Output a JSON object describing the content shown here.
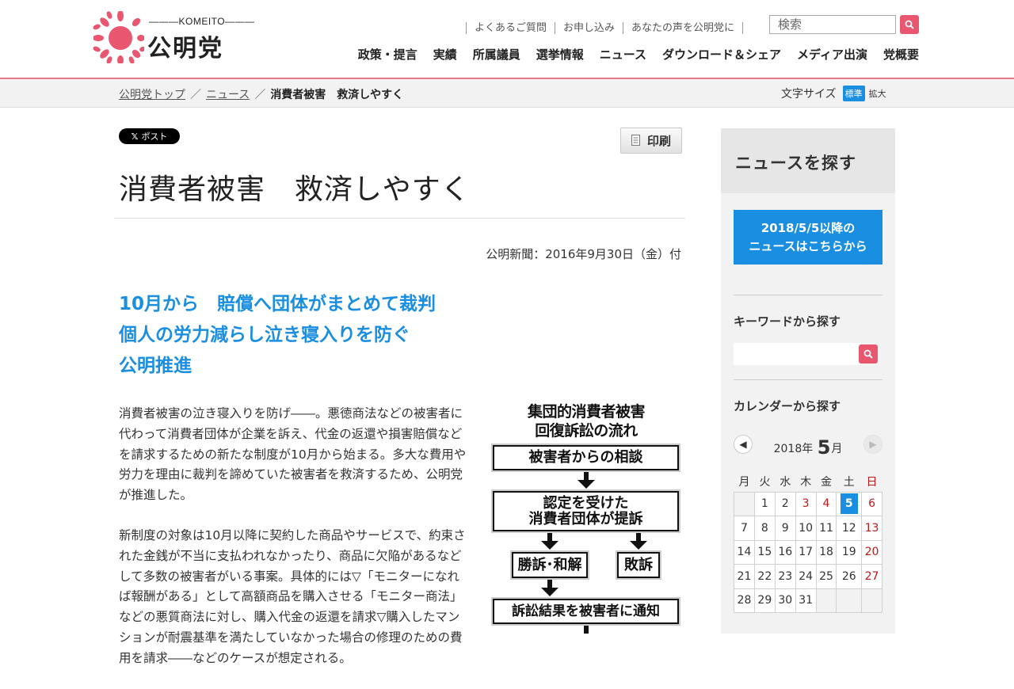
{
  "header": {
    "logo_en": "KOMEITO",
    "logo_ja": "公明党",
    "util_links": [
      "よくあるご質問",
      "お申し込み",
      "あなたの声を公明党に"
    ],
    "search_placeholder": "検索",
    "nav": [
      "政策・提言",
      "実績",
      "所属議員",
      "選挙情報",
      "ニュース",
      "ダウンロード＆シェア",
      "メディア出演",
      "党概要"
    ]
  },
  "breadcrumb": {
    "items": [
      "公明党トップ",
      "ニュース"
    ],
    "separator": "／",
    "current": "消費者被害　救済しやすく"
  },
  "font_size": {
    "label": "文字サイズ",
    "standard": "標準",
    "large": "拡大"
  },
  "article": {
    "tweet_label": "ポスト",
    "print_label": "印刷",
    "title": "消費者被害　救済しやすく",
    "pubdate": "公明新聞：2016年9月30日（金）付",
    "subheads": [
      "10月から　賠償へ団体がまとめて裁判",
      "個人の労力減らし泣き寝入りを防ぐ",
      "公明推進"
    ],
    "paragraphs": [
      "消費者被害の泣き寝入りを防げ――。悪徳商法などの被害者に代わって消費者団体が企業を訴え、代金の返還や損害賠償などを請求するための新たな制度が10月から始まる。多大な費用や労力を理由に裁判を諦めていた被害者を救済するため、公明党が推進した。",
      "新制度の対象は10月以降に契約した商品やサービスで、約束された金銭が不当に支払われなかったり、商品に欠陥があるなどして多数の被害者がいる事案。具体的には▽「モニターになれば報酬がある」として高額商品を購入させる「モニター商法」などの悪質商法に対し、購入代金の返還を請求▽購入したマンションが耐震基準を満たしていなかった場合の修理のための費用を請求――などのケースが想定される。"
    ],
    "figure": {
      "title_lines": [
        "集団的消費者被害",
        "回復訴訟の流れ"
      ],
      "box1": "被害者からの相談",
      "box2_lines": [
        "認定を受けた",
        "消費者団体が提訴"
      ],
      "box3": "勝訴･和解",
      "box4": "敗訴",
      "box5": "訴訟結果を被害者に通知"
    }
  },
  "sidebar": {
    "heading": "ニュースを探す",
    "news_button_lines": [
      "2018/5/5以降の",
      "ニュースはこちらから"
    ],
    "keyword_heading": "キーワードから探す",
    "calendar_heading": "カレンダーから探す",
    "calendar": {
      "year_label": "2018年",
      "month": "5",
      "month_suffix": "月",
      "weekdays": [
        "月",
        "火",
        "水",
        "木",
        "金",
        "土",
        "日"
      ],
      "weeks": [
        [
          "",
          "1",
          "2",
          "3",
          "4",
          "5",
          "6"
        ],
        [
          "7",
          "8",
          "9",
          "10",
          "11",
          "12",
          "13"
        ],
        [
          "14",
          "15",
          "16",
          "17",
          "18",
          "19",
          "20"
        ],
        [
          "21",
          "22",
          "23",
          "24",
          "25",
          "26",
          "27"
        ],
        [
          "28",
          "29",
          "30",
          "31",
          "",
          "",
          ""
        ]
      ],
      "today": "5",
      "holidays": [
        "3",
        "4"
      ]
    }
  },
  "colors": {
    "brand_pink": "#e8576f",
    "accent_blue": "#1a8ee0",
    "holiday_red": "#c01818"
  }
}
